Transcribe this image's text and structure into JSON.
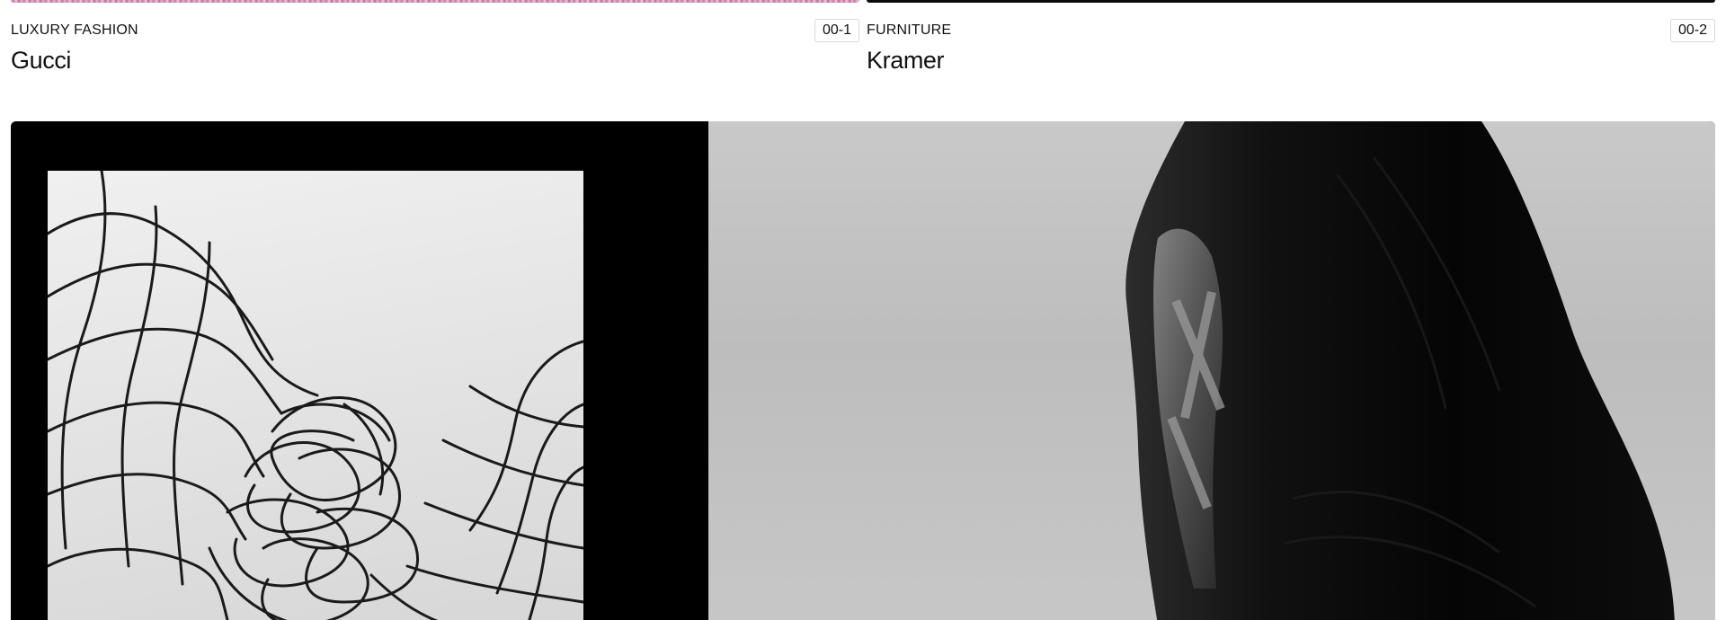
{
  "projects": [
    {
      "category": "LUXURY FASHION",
      "index": "00-1",
      "title": "Gucci"
    },
    {
      "category": "FURNITURE",
      "index": "00-2",
      "title": "Kramer"
    }
  ],
  "feature": {
    "left_image": "wire-mesh-sculpture-photo",
    "right_image": "black-sneaker-closeup-photo"
  },
  "colors": {
    "background": "#ffffff",
    "text": "#111111",
    "badge_border": "#d8d8d8",
    "media_black": "#000000"
  }
}
